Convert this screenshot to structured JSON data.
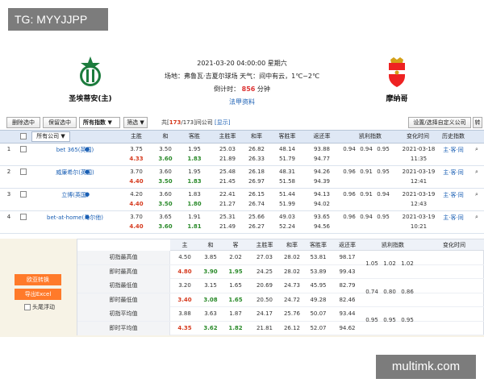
{
  "watermark": "TG: MYYJJPP",
  "footer": "multimk.com",
  "match": {
    "home": "圣埃蒂安(主)",
    "away": "摩纳哥",
    "datetime": "2021-03-20 04:00:00 星期六",
    "venue": "场地：弗鲁瓦·吉夏尔球场 天气：间中有云，1℃~2℃",
    "countdown_label": "倒计时：",
    "countdown_value": "856",
    "countdown_unit": "分钟",
    "law": "法甲资料"
  },
  "toolbar": {
    "delete": "删除选中",
    "keep": "保留选中",
    "all_index": "所有指数",
    "filter": "筛选",
    "company_prefix": "共[",
    "company_count": "173",
    "company_mid": "/173]间公司",
    "show": "[显示]",
    "settings": "设置/选择自定义公司",
    "switch": "转"
  },
  "headers": {
    "company": "所有公司",
    "home": "主胜",
    "draw": "和",
    "away": "客胜",
    "home_rate": "主胜率",
    "draw_rate": "和率",
    "away_rate": "客胜率",
    "return": "返还率",
    "kelly": "凯利指数",
    "change": "变化时间",
    "history": "历史指数"
  },
  "rows": [
    {
      "n": "1",
      "company": "bet 365(英国)",
      "o": [
        "3.75",
        "3.50",
        "1.95"
      ],
      "c": [
        "4.33",
        "3.60",
        "1.83"
      ],
      "hr": [
        "25.03",
        "21.89"
      ],
      "dr": [
        "26.82",
        "26.33"
      ],
      "ar": [
        "48.14",
        "51.79"
      ],
      "ret": [
        "93.88",
        "94.77"
      ],
      "k": [
        "0.94",
        "0.94",
        "0.95"
      ],
      "t": [
        "2021-03-18",
        "11:35"
      ],
      "h": "主·客·同"
    },
    {
      "n": "2",
      "company": "威廉希尔(英国)",
      "o": [
        "3.70",
        "3.60",
        "1.95"
      ],
      "c": [
        "4.40",
        "3.50",
        "1.83"
      ],
      "hr": [
        "25.48",
        "21.45"
      ],
      "dr": [
        "26.18",
        "26.97"
      ],
      "ar": [
        "48.31",
        "51.58"
      ],
      "ret": [
        "94.26",
        "94.39"
      ],
      "k": [
        "0.96",
        "0.91",
        "0.95"
      ],
      "t": [
        "2021-03-19",
        "12:41"
      ],
      "h": "主·客·同"
    },
    {
      "n": "3",
      "company": "立博(英国)",
      "o": [
        "4.20",
        "3.60",
        "1.83"
      ],
      "c": [
        "4.40",
        "3.50",
        "1.80"
      ],
      "hr": [
        "22.41",
        "21.27"
      ],
      "dr": [
        "26.15",
        "26.74"
      ],
      "ar": [
        "51.44",
        "51.99"
      ],
      "ret": [
        "94.13",
        "94.02"
      ],
      "k": [
        "0.96",
        "0.91",
        "0.94"
      ],
      "t": [
        "2021-03-19",
        "12:43"
      ],
      "h": "主·客·同"
    },
    {
      "n": "4",
      "company": "bet-at-home(马尔他)",
      "o": [
        "3.70",
        "3.65",
        "1.91"
      ],
      "c": [
        "4.40",
        "3.60",
        "1.81"
      ],
      "hr": [
        "25.31",
        "21.49"
      ],
      "dr": [
        "25.66",
        "26.27"
      ],
      "ar": [
        "49.03",
        "52.24"
      ],
      "ret": [
        "93.65",
        "94.56"
      ],
      "k": [
        "0.96",
        "0.94",
        "0.95"
      ],
      "t": [
        "2021-03-19",
        "10:21"
      ],
      "h": "主·客·同"
    }
  ],
  "summary": {
    "headers": [
      "主",
      "和",
      "客",
      "主胜率",
      "和率",
      "客胜率",
      "返还率",
      "凯利指数",
      "变化时间"
    ],
    "rows": [
      {
        "label": "初指最高值",
        "v": [
          "4.50",
          "3.85",
          "2.02",
          "27.03",
          "28.02",
          "53.81",
          "98.17"
        ]
      },
      {
        "label": "即时最高值",
        "v": [
          "4.80",
          "3.90",
          "1.95",
          "24.25",
          "28.02",
          "53.89",
          "99.43"
        ]
      },
      {
        "label": "初指最低值",
        "v": [
          "3.20",
          "3.15",
          "1.65",
          "20.69",
          "24.73",
          "45.95",
          "82.79"
        ]
      },
      {
        "label": "即时最低值",
        "v": [
          "3.40",
          "3.08",
          "1.65",
          "20.50",
          "24.72",
          "49.28",
          "82.46"
        ]
      },
      {
        "label": "初指平均值",
        "v": [
          "3.88",
          "3.63",
          "1.87",
          "24.17",
          "25.76",
          "50.07",
          "93.44"
        ]
      },
      {
        "label": "即时平均值",
        "v": [
          "4.35",
          "3.62",
          "1.82",
          "21.81",
          "26.12",
          "52.07",
          "94.62"
        ]
      }
    ],
    "kelly": [
      [
        "1.05",
        "1.02",
        "1.02"
      ],
      [
        "0.74",
        "0.80",
        "0.86"
      ],
      [
        "0.95",
        "0.95",
        "0.95"
      ]
    ]
  },
  "side": {
    "convert": "欧亚转换",
    "export": "导出Excel",
    "float": "头尾浮动"
  }
}
